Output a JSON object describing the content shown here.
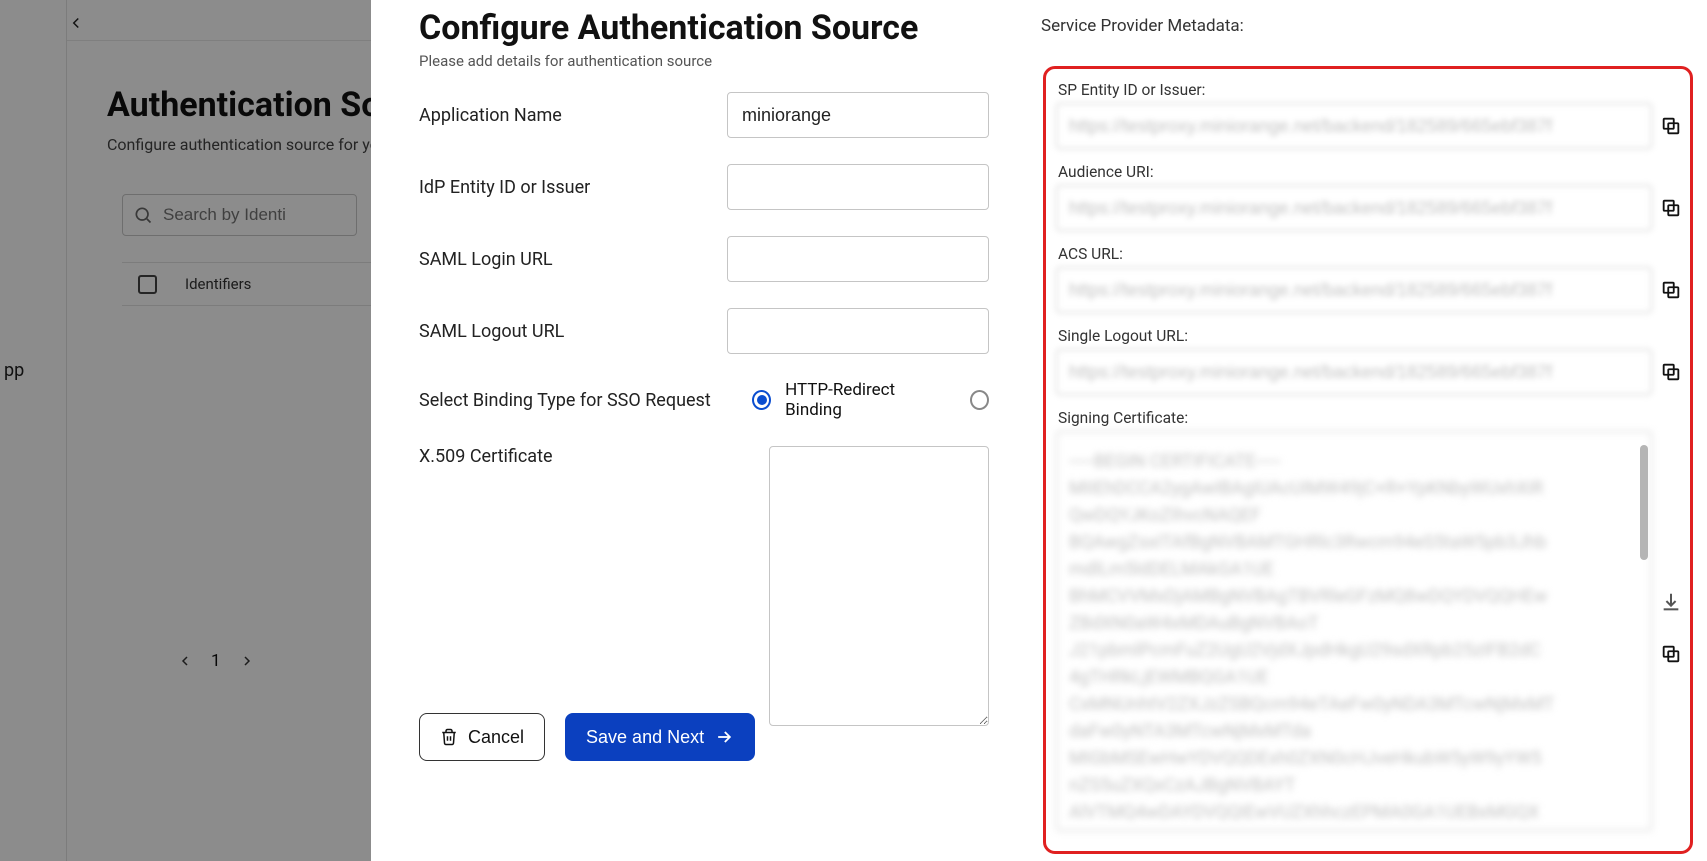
{
  "background": {
    "pp_label": "pp",
    "title": "Authentication Sou",
    "subtitle": "Configure authentication source for you",
    "search_placeholder": "Search by Identi",
    "table_col_identifiers": "Identifiers",
    "page_number": "1"
  },
  "modal": {
    "title": "Configure Authentication Source",
    "subtitle": "Please add details for authentication source",
    "labels": {
      "app_name": "Application Name",
      "idp_entity": "IdP Entity ID or Issuer",
      "saml_login": "SAML Login URL",
      "saml_logout": "SAML Logout URL",
      "binding_type": "Select Binding Type for SSO Request",
      "x509": "X.509 Certificate"
    },
    "values": {
      "app_name": "miniorange",
      "idp_entity": "",
      "saml_login": "",
      "saml_logout": ""
    },
    "radio": {
      "http_redirect": "HTTP-Redirect Binding",
      "http_redirect_selected": true
    },
    "buttons": {
      "cancel": "Cancel",
      "save_next": "Save and Next"
    }
  },
  "sp": {
    "panel_title": "Service Provider Metadata:",
    "labels": {
      "entity_id": "SP Entity ID or Issuer:",
      "audience": "Audience URI:",
      "acs": "ACS URL:",
      "slo": "Single Logout URL:",
      "cert": "Signing Certificate:"
    },
    "values": {
      "entity_id": "https://testproxy.miniorange.net/backend/182589/665ebf387f",
      "audience": "https://testproxy.miniorange.net/backend/182589/665ebf387f",
      "acs": "https://testproxy.miniorange.net/backend/182589/665ebf387f",
      "slo": "https://testproxy.miniorange.net/backend/182589/665ebf387f",
      "cert": "-----BEGIN CERTIFICATE-----\nMIIEhDCCA2ygAwIBAgIUAcUIMW49jC+R+YpKNbyWUxhXiR\nQwDQYJKoZIhvcNAQEF\nBQAwgZsxITAfBgNVBAMTGHRlc3Rwcm94eS5taW5pb3Jhb\nmdlLm5ldDELMAkGA1UE\nBhMCVVMxDjAMBgNVBAgTBVRleGFzMQ8wDQYDVQQHEw\nZBdXN0aW4xMDAuBgNVBAoT\nJ21pbmlPcmFuZ2UgU2VjdXJpdHkgU29sdXRpb25zIFB2dC\n4gTHRkLjEWMBQGA1UE\nCxMNUnhtV2ZXJzZSBQcm94eTAeFw0yNDA3MTcwNjMxMT\ndaFw0yNTA3MTcwNjMxMTda\nMIGbMSEwHwYDVQQDExh0ZXN0cHJveHkubW5yW9yYW5\nnZS5uZXQxCzAJBgNVBAYT\nAlVTMQ4wDAYDVQQIEwVUZXhhczEPMA0GA1UEBxMGQX\nVzdGluMTAwLgYDVQQKEydt"
    }
  }
}
